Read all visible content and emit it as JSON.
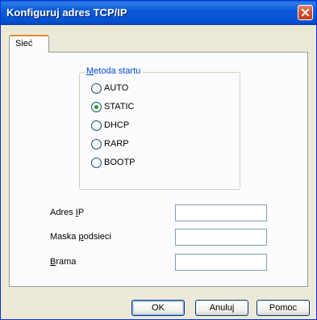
{
  "window": {
    "title": "Konfiguruj adres TCP/IP"
  },
  "tabs": [
    {
      "label": "Sieć",
      "selected": true
    }
  ],
  "startup_method": {
    "legend": "Metoda startu",
    "legend_mnemonic": "M",
    "options": [
      {
        "label": "AUTO",
        "checked": false
      },
      {
        "label": "STATIC",
        "checked": true
      },
      {
        "label": "DHCP",
        "checked": false
      },
      {
        "label": "RARP",
        "checked": false
      },
      {
        "label": "BOOTP",
        "checked": false
      }
    ]
  },
  "fields": {
    "ip": {
      "label_pre": "Adres ",
      "label_mn": "I",
      "label_post": "P",
      "value": ""
    },
    "mask": {
      "label_pre": "Maska ",
      "label_mn": "p",
      "label_post": "odsieci",
      "value": ""
    },
    "gateway": {
      "label_pre": "",
      "label_mn": "B",
      "label_post": "rama",
      "value": ""
    }
  },
  "buttons": {
    "ok": "OK",
    "cancel": "Anuluj",
    "help": "Pomoc"
  },
  "colors": {
    "titlebar": "#0450cf",
    "legend": "#0046d5",
    "close": "#d4502a",
    "radio_dot": "#21a121"
  },
  "icons": {
    "close": "close-icon"
  }
}
